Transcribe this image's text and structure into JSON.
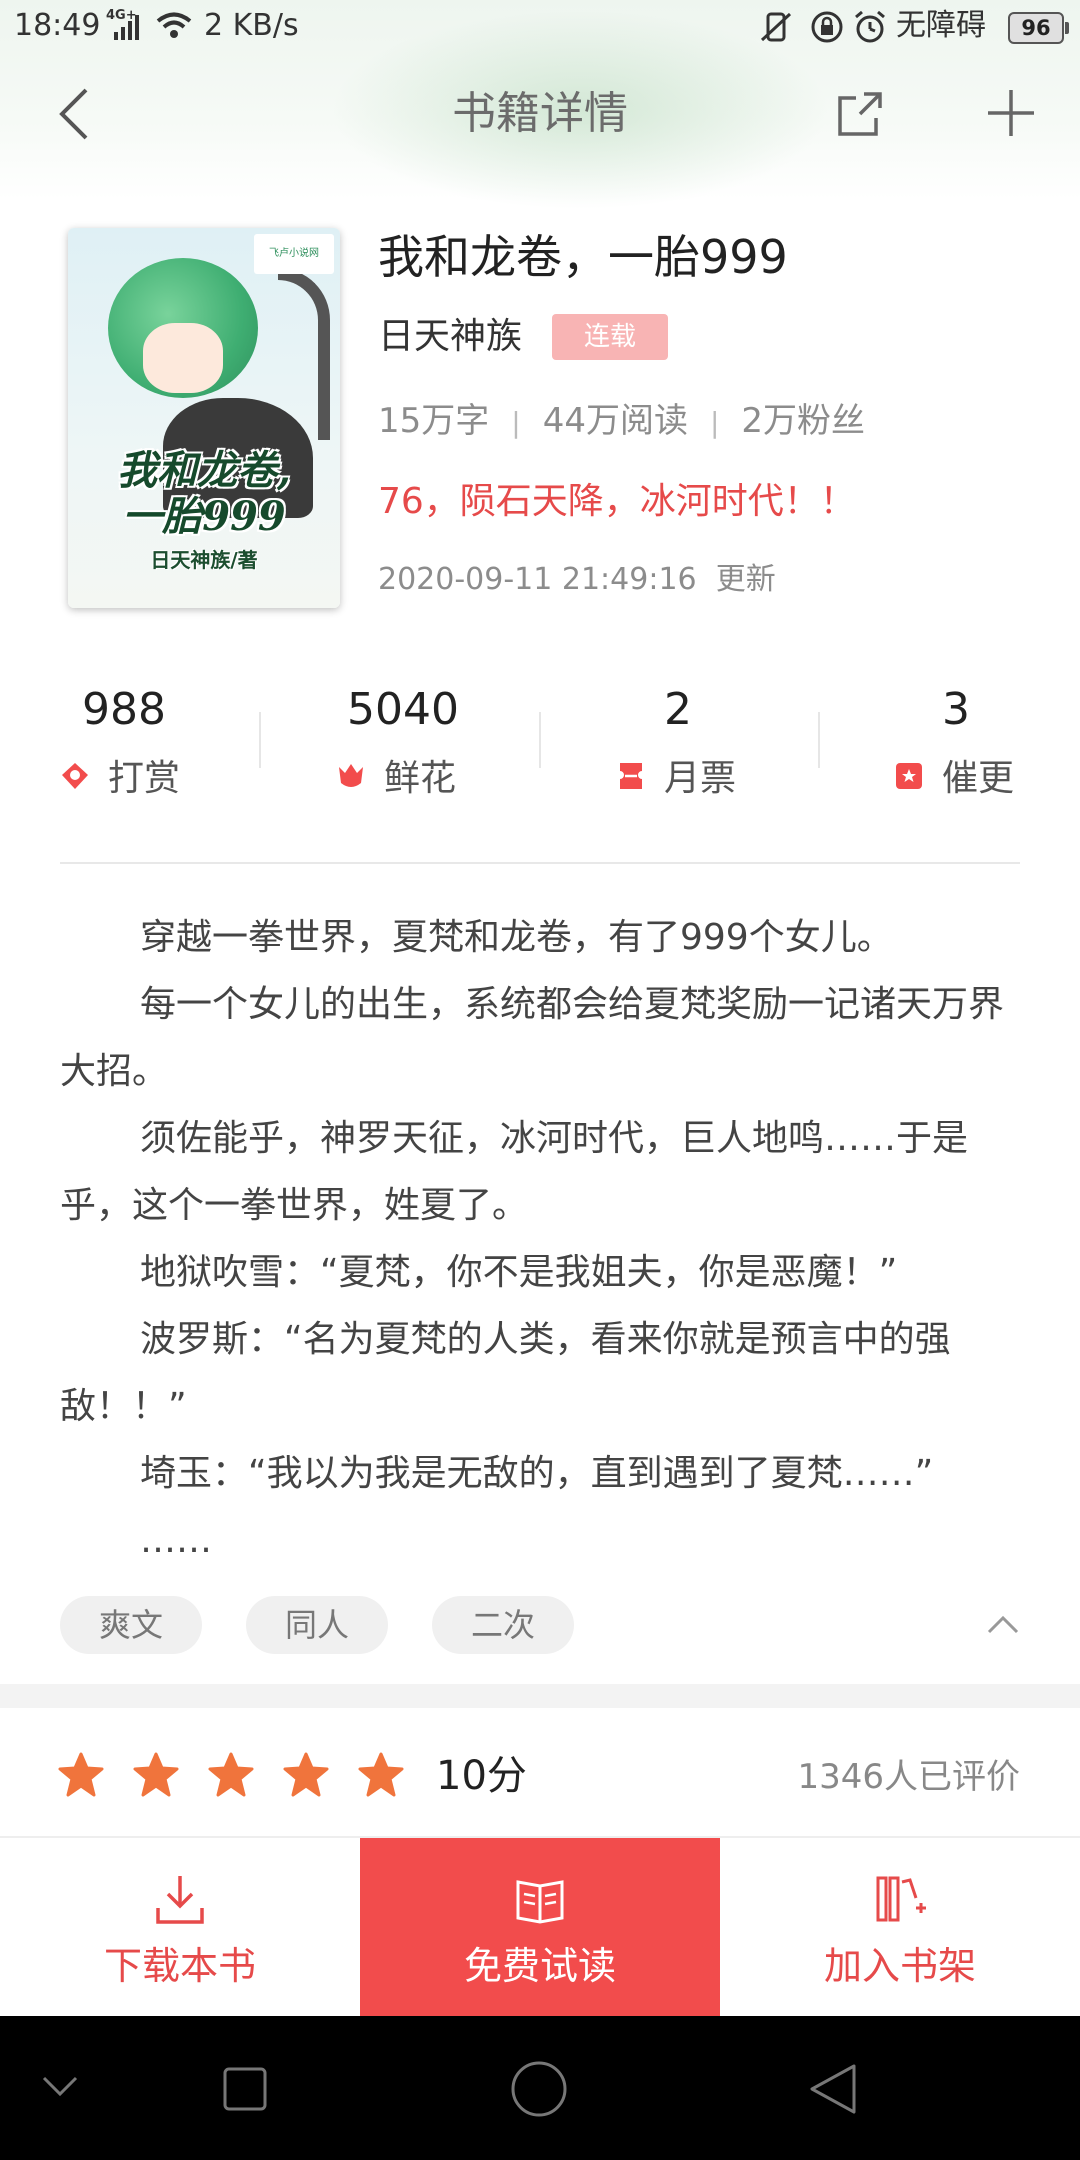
{
  "status_bar": {
    "time": "18:49",
    "network": "4G+",
    "speed": "2 KB/s",
    "accessibility": "无障碍",
    "battery": "96"
  },
  "nav": {
    "title": "书籍详情",
    "back_icon": "chevron-left-icon",
    "share_icon": "share-icon",
    "add_icon": "plus-icon"
  },
  "book": {
    "title": "我和龙卷，一胎999",
    "author": "日天神族",
    "status": "连载",
    "word_count": "15万字",
    "reads": "44万阅读",
    "fans": "2万粉丝",
    "latest_chapter": "76，陨石天降，冰河时代！！",
    "update_time": "2020-09-11 21:49:16",
    "update_suffix": "更新",
    "cover": {
      "title_line1": "我和龙卷,",
      "title_line2": "一胎999",
      "author_line": "日天神族/著",
      "logo": "飞卢小说网"
    }
  },
  "stats": [
    {
      "value": "988",
      "label": "打赏",
      "icon": "reward-icon"
    },
    {
      "value": "5040",
      "label": "鲜花",
      "icon": "flower-icon"
    },
    {
      "value": "2",
      "label": "月票",
      "icon": "ticket-icon"
    },
    {
      "value": "3",
      "label": "催更",
      "icon": "urge-icon"
    }
  ],
  "synopsis": [
    "穿越一拳世界，夏梵和龙卷，有了999个女儿。",
    "每一个女儿的出生，系统都会给夏梵奖励一记诸天万界大招。",
    "须佐能乎，神罗天征，冰河时代，巨人地鸣……于是乎，这个一拳世界，姓夏了。",
    "地狱吹雪：“夏梵，你不是我姐夫，你是恶魔！”",
    "波罗斯：“名为夏梵的人类，看来你就是预言中的强敌！！”",
    "埼玉：“我以为我是无敌的，直到遇到了夏梵……”",
    "……"
  ],
  "tags": [
    "爽文",
    "同人",
    "二次"
  ],
  "rating": {
    "stars": 5,
    "score": "10分",
    "count": "1346人已评价"
  },
  "actions": {
    "download": "下载本书",
    "read": "免费试读",
    "shelf": "加入书架"
  },
  "colors": {
    "accent": "#f24c4c",
    "tag_bg": "#f8b4b4",
    "star": "#f0743c"
  }
}
